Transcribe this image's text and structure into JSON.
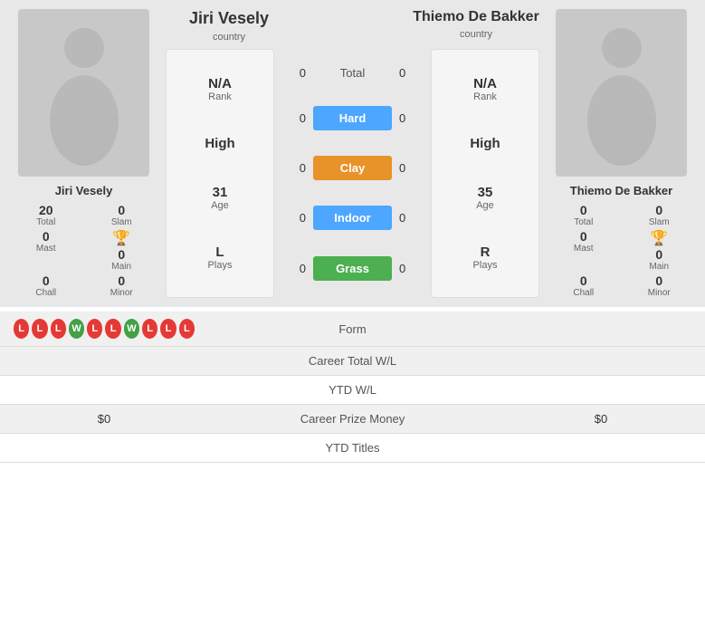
{
  "players": {
    "left": {
      "name": "Jiri Vesely",
      "country": "country",
      "stats": {
        "total": 20,
        "slam": 0,
        "mast": 0,
        "main": 0,
        "chall": 0,
        "minor": 0
      },
      "info": {
        "rank_value": "N/A",
        "rank_label": "Rank",
        "high_value": "High",
        "age_value": "31",
        "age_label": "Age",
        "plays_value": "L",
        "plays_label": "Plays"
      }
    },
    "right": {
      "name": "Thiemo De Bakker",
      "country": "country",
      "stats": {
        "total": 0,
        "slam": 0,
        "mast": 0,
        "main": 0,
        "chall": 0,
        "minor": 0
      },
      "info": {
        "rank_value": "N/A",
        "rank_label": "Rank",
        "high_value": "High",
        "age_value": "35",
        "age_label": "Age",
        "plays_value": "R",
        "plays_label": "Plays"
      }
    }
  },
  "surfaces": {
    "total": {
      "left_score": 0,
      "right_score": 0,
      "label": "Total"
    },
    "hard": {
      "left_score": 0,
      "right_score": 0,
      "label": "Hard",
      "class": "btn-hard"
    },
    "clay": {
      "left_score": 0,
      "right_score": 0,
      "label": "Clay",
      "class": "btn-clay"
    },
    "indoor": {
      "left_score": 0,
      "right_score": 0,
      "label": "Indoor",
      "class": "btn-indoor"
    },
    "grass": {
      "left_score": 0,
      "right_score": 0,
      "label": "Grass",
      "class": "btn-grass"
    }
  },
  "form": {
    "left_badges": [
      "L",
      "L",
      "L",
      "W",
      "L",
      "L",
      "W",
      "L",
      "L",
      "L"
    ],
    "label": "Form"
  },
  "bottom_rows": [
    {
      "left": "",
      "center": "Career Total W/L",
      "right": "",
      "shaded": true,
      "id": "career-total"
    },
    {
      "left": "",
      "center": "YTD W/L",
      "right": "",
      "shaded": false,
      "id": "ytd-wl"
    },
    {
      "left": "$0",
      "center": "Career Prize Money",
      "right": "$0",
      "shaded": true,
      "id": "prize-money"
    },
    {
      "left": "",
      "center": "YTD Titles",
      "right": "",
      "shaded": false,
      "id": "ytd-titles"
    }
  ],
  "labels": {
    "total": "Total",
    "slam": "Slam",
    "mast": "Mast",
    "main": "Main",
    "chall": "Chall",
    "minor": "Minor"
  }
}
